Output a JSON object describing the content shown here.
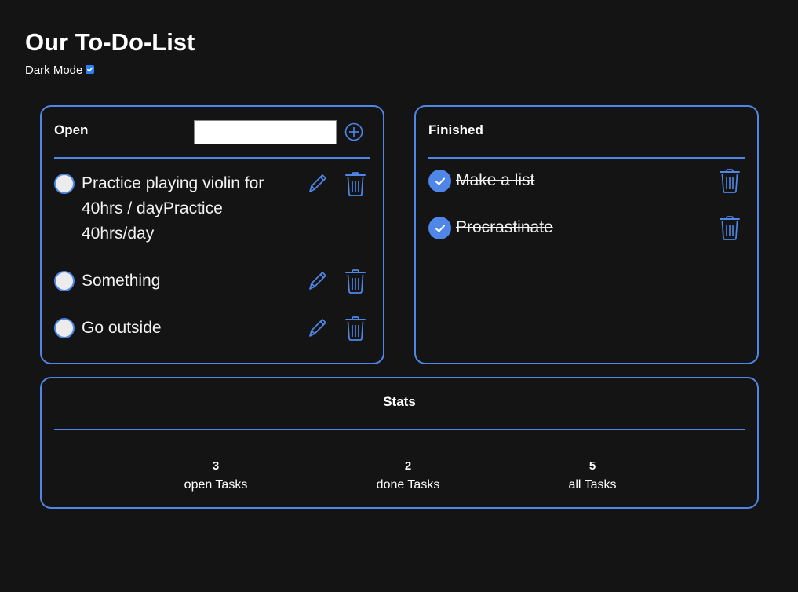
{
  "app": {
    "title": "Our To-Do-List",
    "dark_mode_label": "Dark Mode",
    "dark_mode_checked": true
  },
  "open": {
    "title": "Open",
    "input_value": "",
    "tasks": [
      {
        "text": "Practice playing violin for 40hrs / dayPractice 40hrs/day"
      },
      {
        "text": "Something"
      },
      {
        "text": "Go outside"
      }
    ]
  },
  "finished": {
    "title": "Finished",
    "tasks": [
      {
        "text": "Make a list"
      },
      {
        "text": "Procrastinate"
      }
    ]
  },
  "stats": {
    "title": "Stats",
    "open_count": "3",
    "open_label": "open Tasks",
    "done_count": "2",
    "done_label": "done Tasks",
    "all_count": "5",
    "all_label": "all Tasks"
  },
  "colors": {
    "accent": "#4f86e8",
    "background": "#141414",
    "checkbox": "#2d7ff9"
  },
  "icons": {
    "add": "plus-circle-icon",
    "edit": "pencil-icon",
    "delete": "trash-icon",
    "done": "check-circle-icon"
  }
}
